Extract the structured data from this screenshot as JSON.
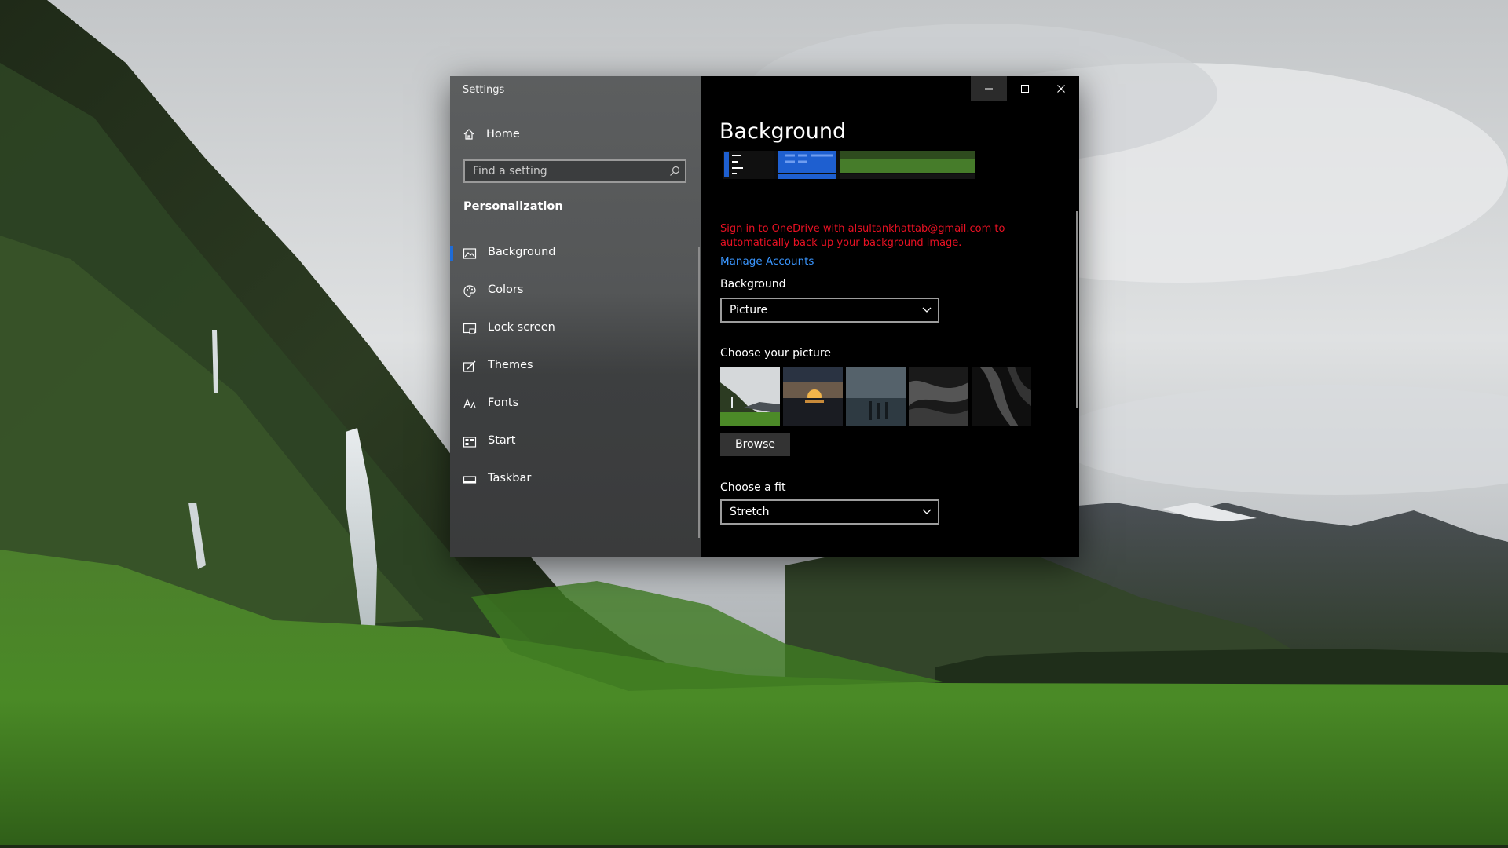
{
  "window": {
    "title": "Settings",
    "controls": [
      "minimize-icon",
      "maximize-icon",
      "close-icon"
    ]
  },
  "nav": {
    "home_label": "Home",
    "search_placeholder": "Find a setting",
    "section_title": "Personalization",
    "items": [
      {
        "label": "Background",
        "icon": "background-icon",
        "selected": true
      },
      {
        "label": "Colors",
        "icon": "palette-icon",
        "selected": false
      },
      {
        "label": "Lock screen",
        "icon": "lock-screen-icon",
        "selected": false
      },
      {
        "label": "Themes",
        "icon": "themes-icon",
        "selected": false
      },
      {
        "label": "Fonts",
        "icon": "fonts-icon",
        "selected": false
      },
      {
        "label": "Start",
        "icon": "start-icon",
        "selected": false
      },
      {
        "label": "Taskbar",
        "icon": "taskbar-icon",
        "selected": false
      }
    ]
  },
  "content": {
    "page_title": "Background",
    "onedrive_message": "Sign in to OneDrive with alsultankhattab@gmail.com to automatically back up your background image.",
    "manage_accounts_link": "Manage Accounts",
    "background_label": "Background",
    "background_value": "Picture",
    "choose_picture_label": "Choose your picture",
    "browse_label": "Browse",
    "choose_fit_label": "Choose a fit",
    "fit_value": "Stretch"
  },
  "colors": {
    "accent": "#1e6bd6",
    "error_text": "#e81123",
    "link": "#3a96ff",
    "content_bg": "#000000"
  }
}
